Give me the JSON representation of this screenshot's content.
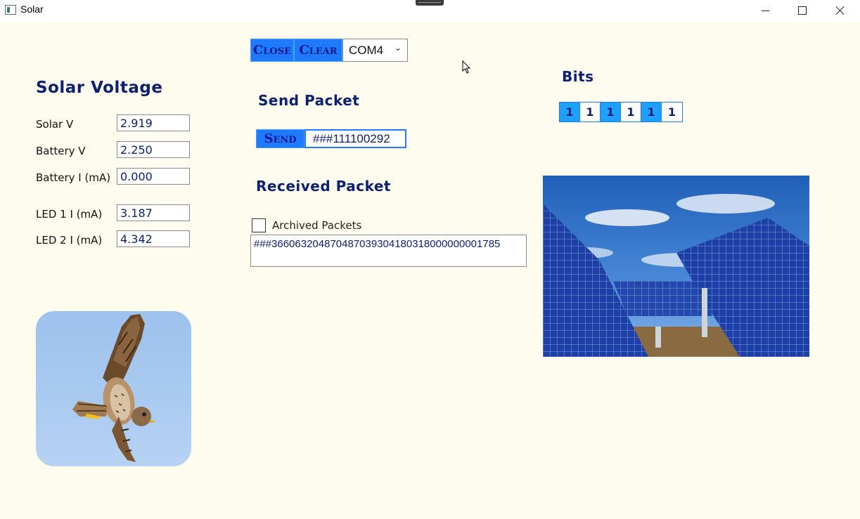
{
  "window": {
    "title": "Solar"
  },
  "controls": {
    "close_label": "Close",
    "clear_label": "Clear",
    "port_value": "COM4"
  },
  "solar_voltage": {
    "heading": "Solar Voltage",
    "fields": [
      {
        "label": "Solar V",
        "value": "2.919"
      },
      {
        "label": "Battery V",
        "value": "2.250"
      },
      {
        "label": "Battery I (mA)",
        "value": "0.000"
      },
      {
        "label": "LED 1 I (mA)",
        "value": "3.187"
      },
      {
        "label": "LED 2 I (mA)",
        "value": "4.342"
      }
    ]
  },
  "send_packet": {
    "heading": "Send Packet",
    "send_label": "Send",
    "value": "###111100292"
  },
  "received_packet": {
    "heading": "Received Packet",
    "archived_label": "Archived Packets",
    "archived_checked": false,
    "value": "###366063204870487039304180318000000001785"
  },
  "bits": {
    "heading": "Bits",
    "values": [
      "1",
      "1",
      "1",
      "1",
      "1",
      "1"
    ],
    "states": [
      "on",
      "off",
      "on",
      "off",
      "on",
      "off"
    ]
  },
  "colors": {
    "background": "#fefcee",
    "heading": "#0b1f73",
    "button": "#1e7bff",
    "bit_on": "#1ea0ff"
  },
  "images": {
    "bird": "kestrel-bird-photo",
    "solar": "solar-panels-photo"
  }
}
